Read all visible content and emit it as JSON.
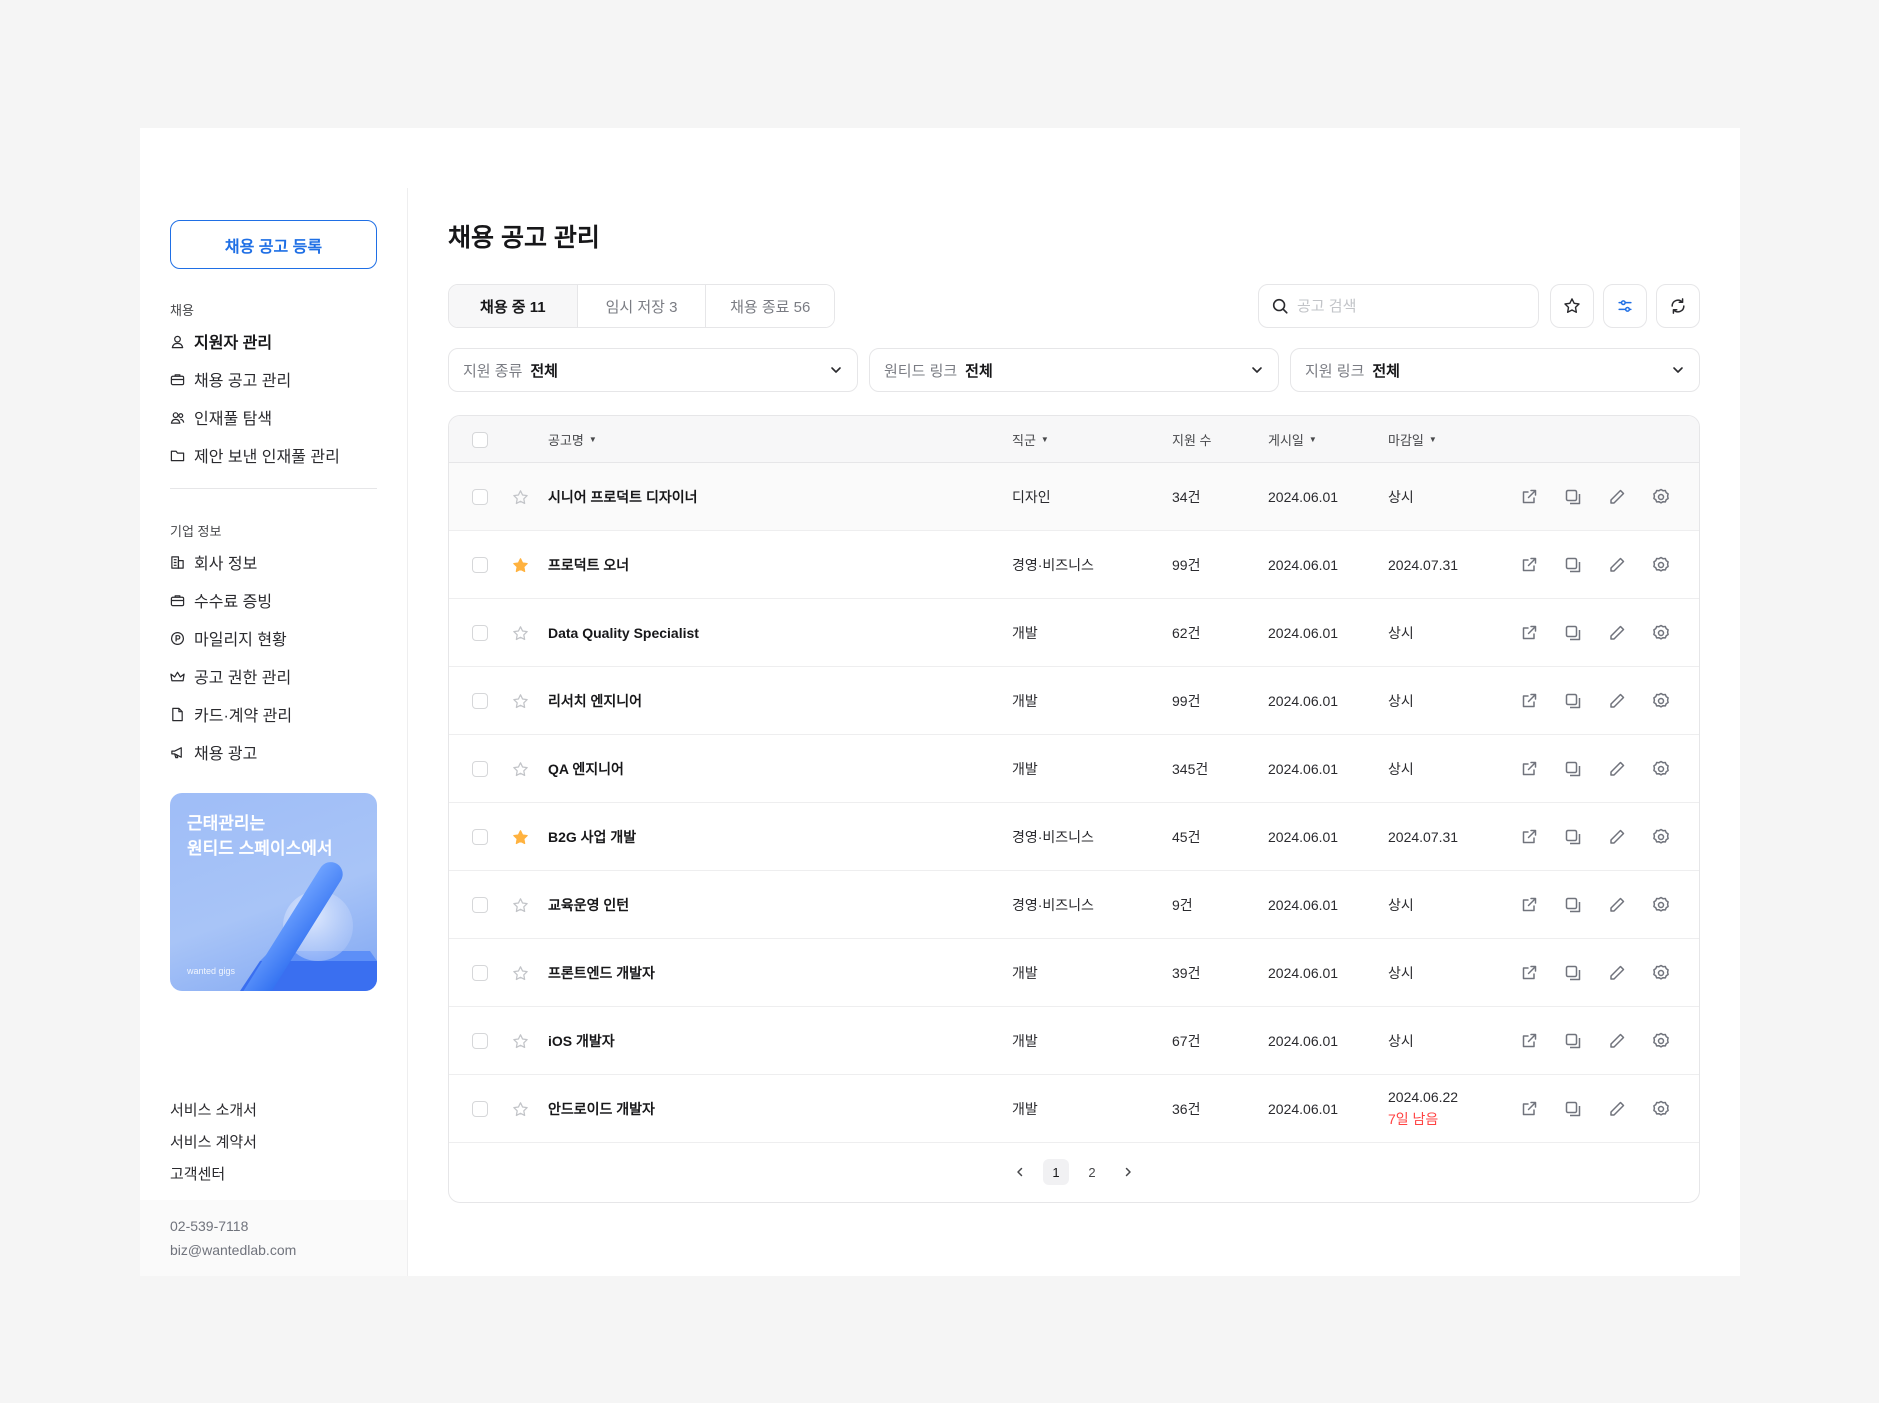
{
  "sidebar": {
    "register_button": "채용 공고 등록",
    "section_recruit": "채용",
    "recruit_items": [
      {
        "label": "지원자 관리",
        "icon": "person-icon",
        "active": true
      },
      {
        "label": "채용 공고 관리",
        "icon": "briefcase-icon"
      },
      {
        "label": "인재풀 탐색",
        "icon": "people-icon"
      },
      {
        "label": "제안 보낸 인재풀 관리",
        "icon": "folder-icon"
      }
    ],
    "section_company": "기업 정보",
    "company_items": [
      {
        "label": "회사 정보",
        "icon": "building-icon"
      },
      {
        "label": "수수료 증빙",
        "icon": "briefcase-icon"
      },
      {
        "label": "마일리지 현황",
        "icon": "coin-icon"
      },
      {
        "label": "공고 권한 관리",
        "icon": "crown-icon"
      },
      {
        "label": "카드·계약 관리",
        "icon": "document-icon"
      },
      {
        "label": "채용 광고",
        "icon": "megaphone-icon"
      }
    ],
    "promo": {
      "line1": "근태관리는",
      "line2": "원티드 스페이스에서",
      "brand": "wanted gigs"
    },
    "footer_links": [
      "서비스 소개서",
      "서비스 계약서",
      "고객센터"
    ],
    "contact": {
      "phone": "02-539-7118",
      "email": "biz@wantedlab.com"
    }
  },
  "main": {
    "title": "채용 공고 관리",
    "tabs": [
      {
        "label": "채용 중 11",
        "active": true
      },
      {
        "label": "임시 저장 3"
      },
      {
        "label": "채용 종료 56"
      }
    ],
    "search_placeholder": "공고 검색",
    "filters": [
      {
        "label": "지원 종류",
        "value": "전체"
      },
      {
        "label": "원티드 링크",
        "value": "전체"
      },
      {
        "label": "지원 링크",
        "value": "전체"
      }
    ],
    "table": {
      "headers": {
        "title": "공고명",
        "job": "직군",
        "applicants": "지원 수",
        "posted": "게시일",
        "deadline": "마감일"
      },
      "rows": [
        {
          "title": "시니어 프로덕트 디자이너",
          "job": "디자인",
          "applicants": "34건",
          "posted": "2024.06.01",
          "deadline": "상시",
          "starred": false
        },
        {
          "title": "프로덕트 오너",
          "job": "경영·비즈니스",
          "applicants": "99건",
          "posted": "2024.06.01",
          "deadline": "2024.07.31",
          "starred": true
        },
        {
          "title": "Data Quality Specialist",
          "job": "개발",
          "applicants": "62건",
          "posted": "2024.06.01",
          "deadline": "상시",
          "starred": false
        },
        {
          "title": "리서치 엔지니어",
          "job": "개발",
          "applicants": "99건",
          "posted": "2024.06.01",
          "deadline": "상시",
          "starred": false
        },
        {
          "title": "QA 엔지니어",
          "job": "개발",
          "applicants": "345건",
          "posted": "2024.06.01",
          "deadline": "상시",
          "starred": false
        },
        {
          "title": "B2G 사업 개발",
          "job": "경영·비즈니스",
          "applicants": "45건",
          "posted": "2024.06.01",
          "deadline": "2024.07.31",
          "starred": true
        },
        {
          "title": "교육운영 인턴",
          "job": "경영·비즈니스",
          "applicants": "9건",
          "posted": "2024.06.01",
          "deadline": "상시",
          "starred": false
        },
        {
          "title": "프론트엔드 개발자",
          "job": "개발",
          "applicants": "39건",
          "posted": "2024.06.01",
          "deadline": "상시",
          "starred": false
        },
        {
          "title": "iOS 개발자",
          "job": "개발",
          "applicants": "67건",
          "posted": "2024.06.01",
          "deadline": "상시",
          "starred": false
        },
        {
          "title": "안드로이드 개발자",
          "job": "개발",
          "applicants": "36건",
          "posted": "2024.06.01",
          "deadline": "2024.06.22",
          "deadline_note": "7일 남음",
          "starred": false
        }
      ]
    },
    "pagination": {
      "pages": [
        "1",
        "2"
      ],
      "current": "1"
    }
  },
  "colors": {
    "accent": "#1f6fe5",
    "star": "#ffb23f",
    "warning": "#ff4242"
  }
}
